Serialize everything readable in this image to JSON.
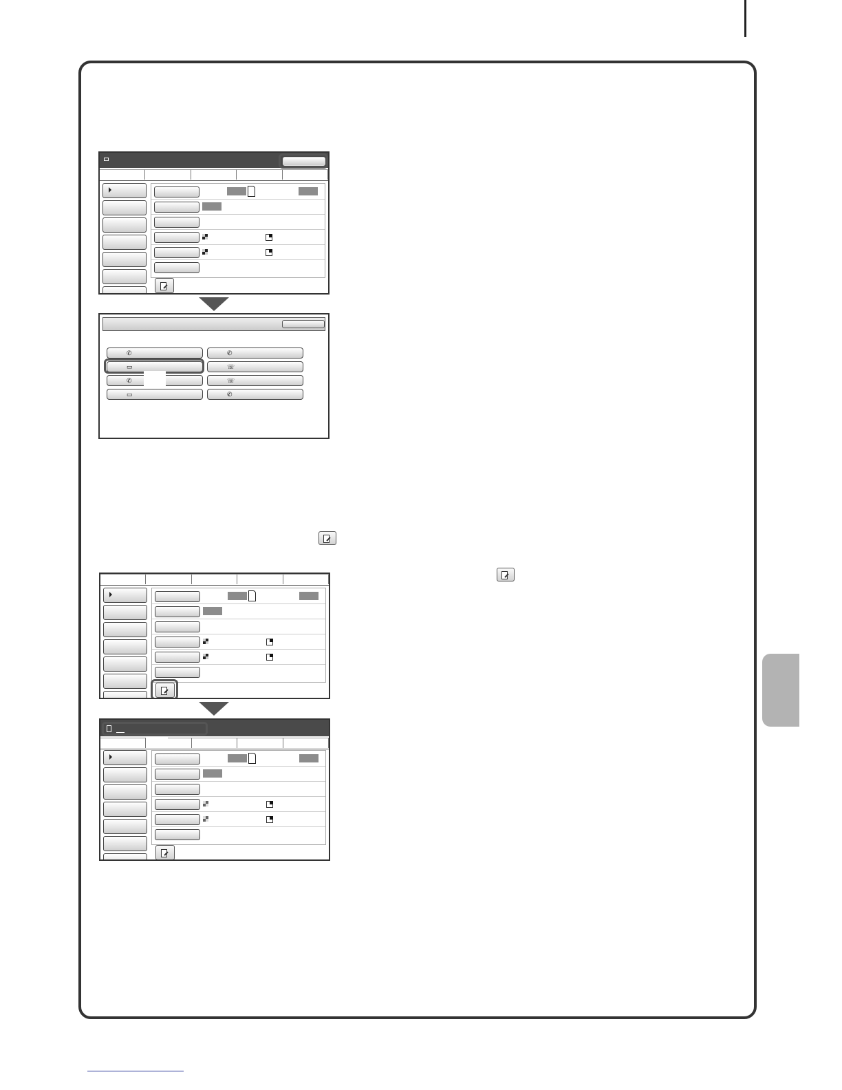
{
  "page": {
    "frame_color": "#333333",
    "side_tab_color": "#b3b3b3",
    "footer_link_color": "#2b3a9a"
  },
  "screens": {
    "main_screen_top": {
      "left_menu_count": 7,
      "has_title_bar": true
    },
    "selection_screen": {
      "selection_buttons": [
        "phone-icon",
        "mailbox-icon",
        "phone-icon",
        "mailbox-icon",
        "phone-icon",
        "phone-forward-icon",
        "phone-forward-icon",
        "phone-icon"
      ]
    },
    "main_screen_no_title": {
      "left_menu_count": 7
    },
    "main_screen_with_address": {
      "address_bar_text": ""
    }
  },
  "icons": {
    "program_register": "program-register-icon",
    "paper": "paper-icon",
    "exposure": "checker-icon",
    "resolution": "corner-icon"
  }
}
